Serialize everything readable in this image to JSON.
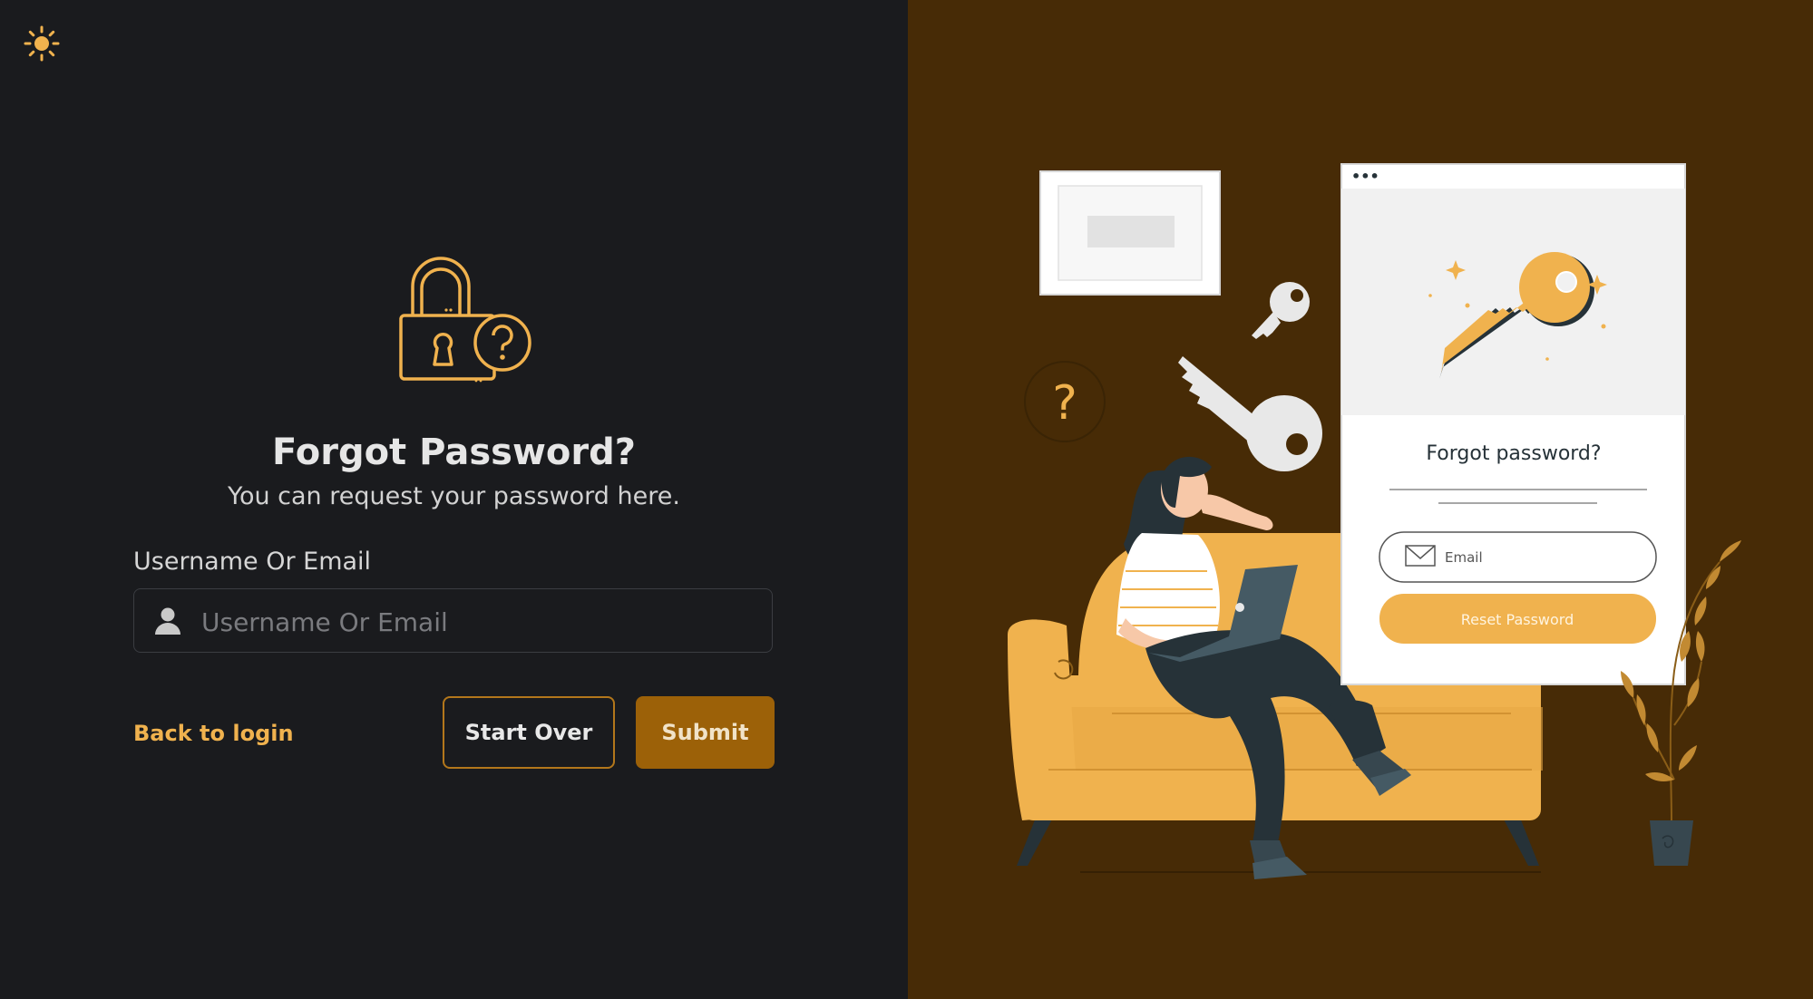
{
  "theme": {
    "toggle_icon": "sun-icon",
    "accent": "#f0b24e",
    "left_bg": "#1a1b1e",
    "right_bg": "#472b06",
    "submit_bg": "#9c6108"
  },
  "form": {
    "icon": "lock-question-icon",
    "title": "Forgot Password?",
    "subtitle": "You can request your password here.",
    "field_label": "Username Or Email",
    "field_placeholder": "Username Or Email",
    "field_value": "",
    "field_icon": "user-icon",
    "back_label": "Back to login",
    "start_over_label": "Start Over",
    "submit_label": "Submit"
  },
  "illustration": {
    "card_title": "Forgot password?",
    "card_email_placeholder": "Email",
    "card_button_label": "Reset Password",
    "question_mark": "?",
    "dots": "•••"
  }
}
